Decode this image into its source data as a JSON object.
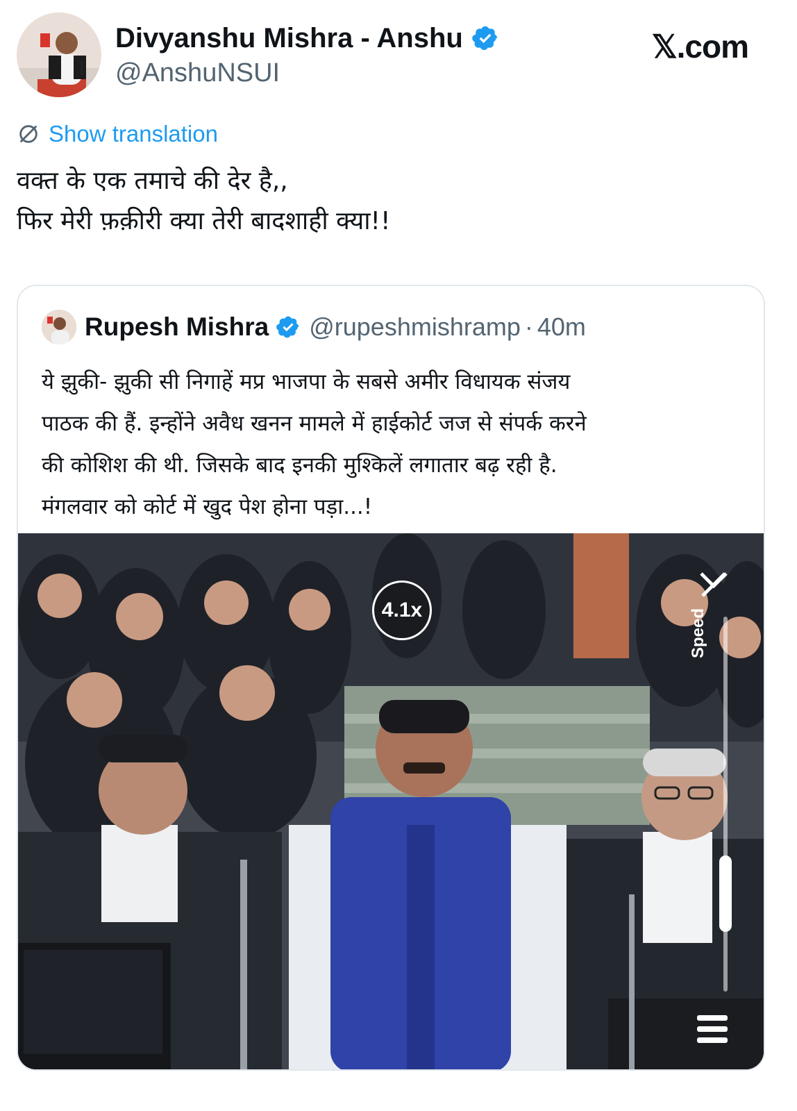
{
  "header": {
    "display_name": "Divyanshu Mishra - Anshu",
    "handle": "@AnshuNSUI",
    "watermark": "𝕏.com",
    "verified_color": "#1d9bf0"
  },
  "translate": {
    "label": "Show translation"
  },
  "tweet": {
    "text": "वक्त के एक तमाचे की देर है,,\nफिर मेरी फ़क़ीरी क्या तेरी बादशाही क्या!!"
  },
  "quote": {
    "name": "Rupesh Mishra",
    "handle": "@rupeshmishramp",
    "separator": "·",
    "time": "40m",
    "text": "ये झुकी- झुकी सी निगाहें मप्र भाजपा के सबसे अमीर विधायक संजय\nपाठक की हैं. इन्होंने अवैध खनन मामले में हाईकोर्ट जज से संपर्क करने\nकी कोशिश की थी. जिसके बाद इनकी मुश्किलें लगातार बढ़ रही है.\nमंगलवार को कोर्ट में खुद पेश होना पड़ा...!"
  },
  "media": {
    "speed_badge": "4.1x",
    "speed_label": "Speed",
    "speed_level": 0.2
  },
  "colors": {
    "accent": "#1d9bf0",
    "text": "#0f1419",
    "secondary": "#536471"
  }
}
